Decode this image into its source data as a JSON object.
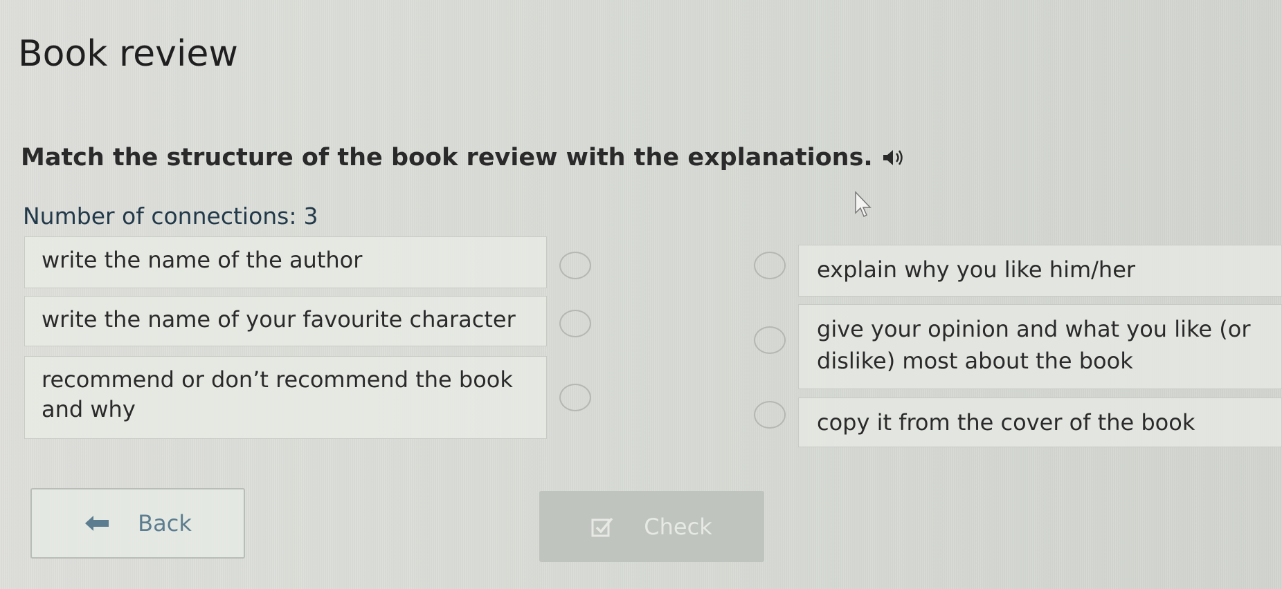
{
  "page": {
    "title": "Book review",
    "instruction": "Match the structure of the book review with the explanations.",
    "audio_icon": "speaker-icon",
    "connections_label": "Number of connections:",
    "connections_count": "3"
  },
  "left_items": [
    {
      "lines": [
        "write the name of the author"
      ]
    },
    {
      "lines": [
        "write the name of your favourite character"
      ]
    },
    {
      "lines": [
        "recommend or don’t recommend the book",
        "and why"
      ]
    }
  ],
  "right_items": [
    {
      "lines": [
        "explain why you like him/her"
      ]
    },
    {
      "lines": [
        "give your opinion and what you like (or",
        "dislike) most about the book"
      ]
    },
    {
      "lines": [
        "copy it from the cover of the book"
      ]
    }
  ],
  "buttons": {
    "back_label": "Back",
    "back_icon": "arrow-left-icon",
    "check_label": "Check",
    "check_icon": "checkbox-icon"
  },
  "colors": {
    "background": "#d9dcd6",
    "item_background": "#e7eae4",
    "check_button_disabled": "#c0c4bf",
    "back_text": "#5c7d8f"
  }
}
